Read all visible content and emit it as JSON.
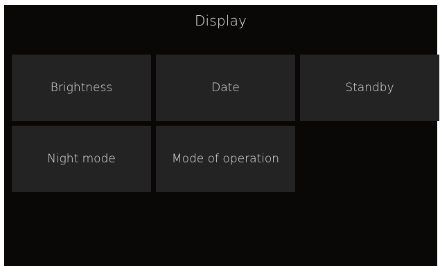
{
  "header": {
    "title": "Display"
  },
  "menu": {
    "items": [
      {
        "label": "Brightness"
      },
      {
        "label": "Date"
      },
      {
        "label": "Standby"
      },
      {
        "label": "Night mode"
      },
      {
        "label": "Mode of operation"
      }
    ]
  },
  "colors": {
    "background": "#0a0806",
    "tile": "#232323",
    "text": "#e6e6e6"
  }
}
